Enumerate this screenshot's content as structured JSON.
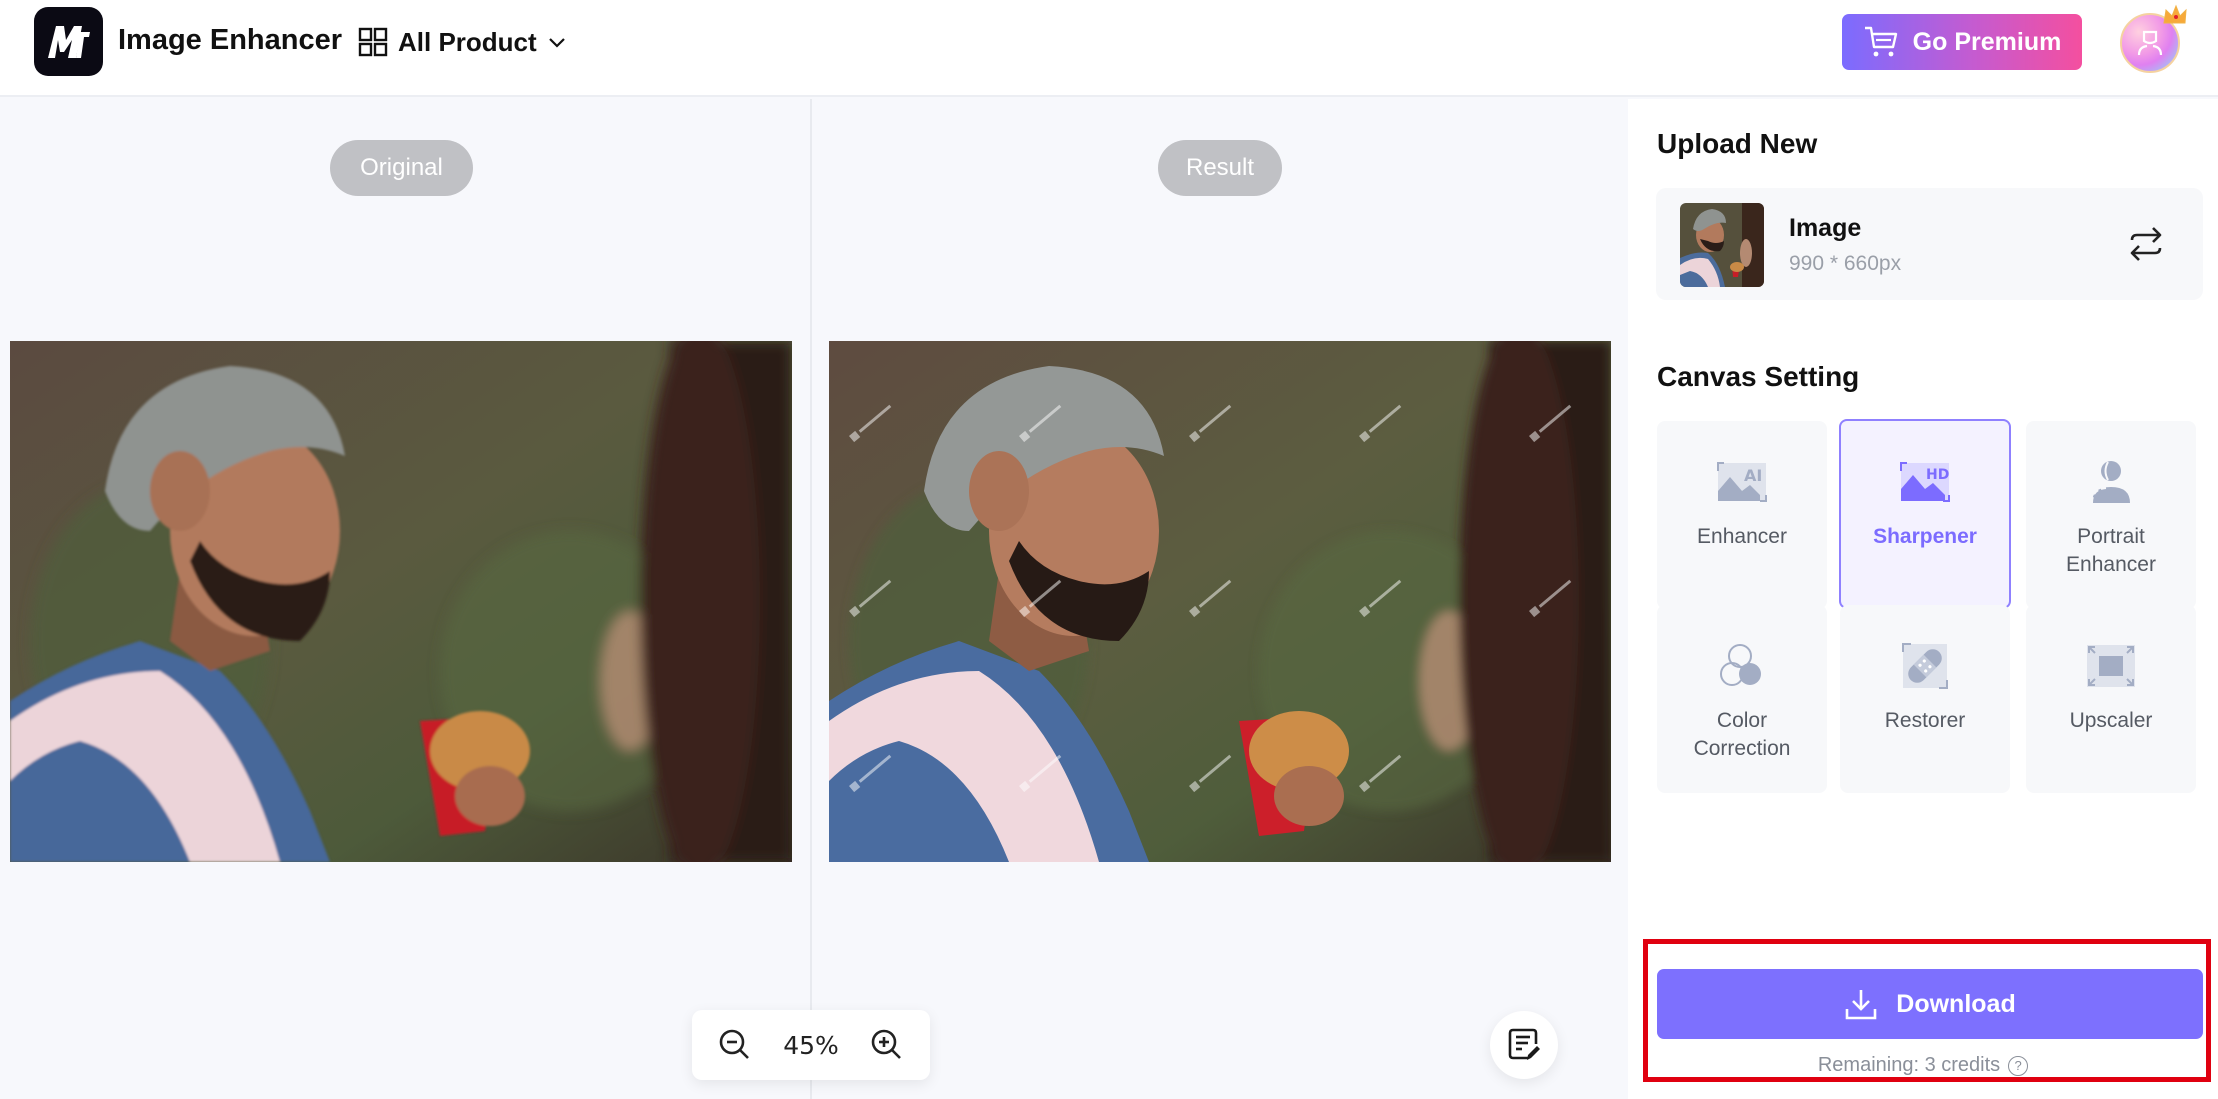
{
  "header": {
    "app_title": "Image Enhancer",
    "all_product_label": "All Product",
    "premium_label": "Go Premium",
    "icons": {
      "logo": "mt-logo-icon",
      "grid": "grid-icon",
      "chevron": "chevron-down-icon",
      "cart": "cart-icon",
      "avatar": "user-avatar-icon",
      "crown": "crown-icon"
    }
  },
  "canvas": {
    "original_label": "Original",
    "result_label": "Result",
    "zoom_level": "45%",
    "icons": {
      "zoom_out": "zoom-out-icon",
      "zoom_in": "zoom-in-icon",
      "notes": "notes-edit-icon"
    }
  },
  "sidebar": {
    "upload_title": "Upload New",
    "image": {
      "name": "Image",
      "dimensions": "990 * 660px"
    },
    "canvas_title": "Canvas Setting",
    "tools": [
      {
        "label": "Enhancer",
        "icon": "ai-image-icon",
        "active": false
      },
      {
        "label": "Sharpener",
        "icon": "hd-image-icon",
        "active": true
      },
      {
        "label": "Portrait Enhancer",
        "icon": "portrait-icon",
        "active": false
      },
      {
        "label": "Color Correction",
        "icon": "color-circles-icon",
        "active": false
      },
      {
        "label": "Restorer",
        "icon": "bandage-icon",
        "active": false
      },
      {
        "label": "Upscaler",
        "icon": "expand-icon",
        "active": false
      }
    ],
    "download_label": "Download",
    "credits_text": "Remaining: 3 credits",
    "help_glyph": "?"
  },
  "colors": {
    "accent": "#7d70fe",
    "accent_active_text": "#7c6cff",
    "premium_gradient_start": "#7b6cff",
    "premium_gradient_end": "#f44f9f",
    "highlight_frame": "#e00010"
  }
}
